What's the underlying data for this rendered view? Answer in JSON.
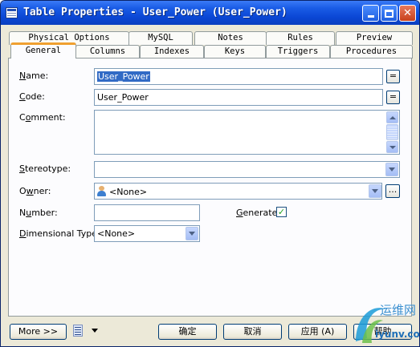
{
  "window": {
    "title": "Table Properties - User_Power (User_Power)"
  },
  "tabs": {
    "row_back": [
      "Physical Options",
      "MySQL",
      "Notes",
      "Rules",
      "Preview"
    ],
    "row_front": [
      "General",
      "Columns",
      "Indexes",
      "Keys",
      "Triggers",
      "Procedures"
    ],
    "active": "General"
  },
  "form": {
    "name_label": "Name:",
    "name_value": "User_Power",
    "code_label": "Code:",
    "code_value": "User_Power",
    "comment_label": "Comment:",
    "comment_value": "",
    "stereotype_label": "Stereotype:",
    "stereotype_value": "",
    "owner_label": "Owner:",
    "owner_value": "<None>",
    "number_label": "Number:",
    "number_value": "",
    "generate_label": "Generate:",
    "generate_checked": true,
    "dimensional_label": "Dimensional Type:",
    "dimensional_value": "<None>",
    "equals_glyph": "=",
    "ellipsis_glyph": "..."
  },
  "footer": {
    "more_label": "More >>",
    "ok_label": "确定",
    "cancel_label": "取消",
    "apply_label": "应用 (A)",
    "help_label": "帮助"
  },
  "watermark": {
    "text_cn": "运维网",
    "text_url": "iyunv.com"
  },
  "colors": {
    "titlebar": "#0a46d4",
    "tab_highlight": "#f0a030",
    "selection": "#316ac5",
    "dialog_bg": "#ece9d8"
  }
}
